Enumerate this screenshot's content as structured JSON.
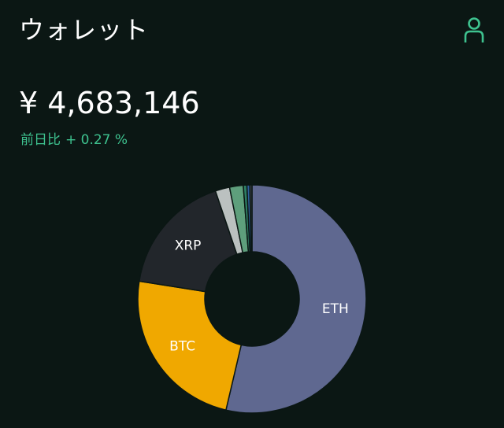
{
  "header": {
    "title": "ウォレット",
    "profile_icon": "person-outline-icon"
  },
  "portfolio": {
    "total": "¥ 4,683,146",
    "change_label": "前日比",
    "change_value": "+ 0.27 %"
  },
  "colors": {
    "background": "#0b1714",
    "accent": "#3ec28f"
  },
  "chart_data": {
    "type": "pie",
    "donut": true,
    "slices": [
      {
        "label": "ETH",
        "value": 52.7,
        "color": "#5f6890"
      },
      {
        "label": "BTC",
        "value": 23.4,
        "color": "#f0a800"
      },
      {
        "label": "XRP",
        "value": 17.0,
        "color": "#22262b"
      },
      {
        "label": "",
        "value": 2.0,
        "color": "#bbc1c0"
      },
      {
        "label": "",
        "value": 1.9,
        "color": "#5e9f7c"
      },
      {
        "label": "",
        "value": 0.5,
        "color": "#2e7d63"
      },
      {
        "label": "",
        "value": 0.4,
        "color": "#2f5f9e"
      },
      {
        "label": "",
        "value": 0.3,
        "color": "#3a3f47"
      }
    ]
  }
}
